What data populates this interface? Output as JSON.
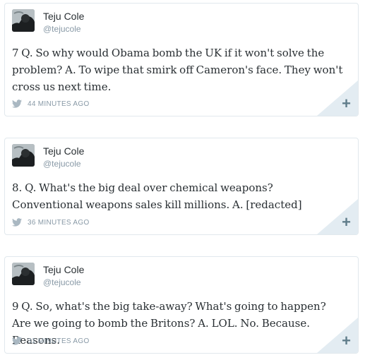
{
  "tweets": [
    {
      "name": "Teju Cole",
      "handle": "@tejucole",
      "text": "7 Q. So why would Obama bomb the UK if it won't solve the problem? A. To wipe that smirk off Cameron's face. They won't cross us next time.",
      "time": "44 MINUTES AGO",
      "bird_icon": "twitter-bird-icon",
      "action_icon": "plus-icon"
    },
    {
      "name": "Teju Cole",
      "handle": "@tejucole",
      "text": "8. Q. What's the big deal over chemical weapons? Conventional weapons sales kill millions. A. [redacted]",
      "time": "36 MINUTES AGO",
      "bird_icon": "twitter-bird-icon",
      "action_icon": "plus-icon"
    },
    {
      "name": "Teju Cole",
      "handle": "@tejucole",
      "text": "9 Q. So, what's the big take-away? What's going to happen? Are we going to bomb the Britons? A. LOL. No. Because. Reasons.",
      "time": "31 MINUTES AGO",
      "bird_icon": "twitter-bird-icon",
      "action_icon": "plus-icon"
    }
  ],
  "colors": {
    "border": "#e1e8ed",
    "corner": "#e3ecf2",
    "plus": "#607d8b",
    "muted": "#8899a6",
    "text": "#292f33"
  }
}
